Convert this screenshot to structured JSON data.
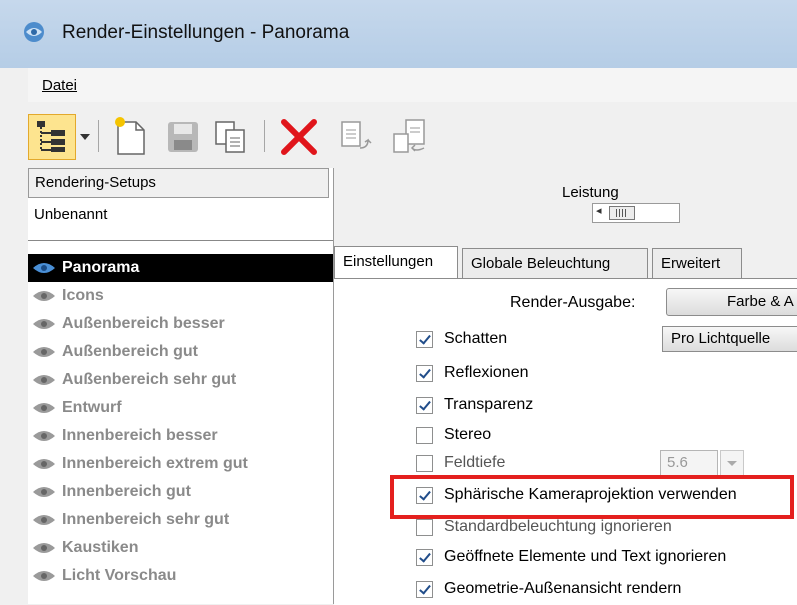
{
  "window": {
    "title": "Render-Einstellungen - Panorama"
  },
  "menu": {
    "file_label": "Datei"
  },
  "toolbar": {
    "icons": [
      "tree-view-icon",
      "dropdown-arrow-icon",
      "new-document-icon",
      "save-icon",
      "copy-icon",
      "delete-icon",
      "export-icon",
      "import-icon"
    ]
  },
  "left_panel": {
    "header": "Rendering-Setups",
    "unnamed": "Unbenannt",
    "items": [
      {
        "label": "Panorama",
        "selected": true
      },
      {
        "label": "Icons"
      },
      {
        "label": "Außenbereich besser"
      },
      {
        "label": "Außenbereich gut"
      },
      {
        "label": "Außenbereich sehr gut"
      },
      {
        "label": "Entwurf"
      },
      {
        "label": "Innenbereich besser"
      },
      {
        "label": "Innenbereich extrem gut"
      },
      {
        "label": "Innenbereich gut"
      },
      {
        "label": "Innenbereich sehr gut"
      },
      {
        "label": "Kaustiken"
      },
      {
        "label": "Licht Vorschau"
      }
    ]
  },
  "right_panel": {
    "performance_label": "Leistung",
    "tabs": [
      {
        "label": "Einstellungen",
        "active": true
      },
      {
        "label": "Globale Beleuchtung"
      },
      {
        "label": "Erweitert"
      }
    ],
    "render_output_label": "Render-Ausgabe:",
    "render_output_value": "Farbe & A",
    "shadow_mode_value": "Pro Lichtquelle",
    "depth_value": "5.6",
    "options": [
      {
        "label": "Schatten",
        "checked": true
      },
      {
        "label": "Reflexionen",
        "checked": true
      },
      {
        "label": "Transparenz",
        "checked": true
      },
      {
        "label": "Stereo",
        "checked": false
      },
      {
        "label": "Feldtiefe",
        "checked": false
      },
      {
        "label": "Sphärische Kameraprojektion verwenden",
        "checked": true
      },
      {
        "label": "Standardbeleuchtung ignorieren",
        "checked": false
      },
      {
        "label": "Geöffnete Elemente und Text ignorieren",
        "checked": true
      },
      {
        "label": "Geometrie-Außenansicht rendern",
        "checked": true
      }
    ]
  },
  "colors": {
    "highlight": "#e4201e",
    "toolbar_selected": "#fde48f",
    "checkmark": "#214d8a"
  }
}
